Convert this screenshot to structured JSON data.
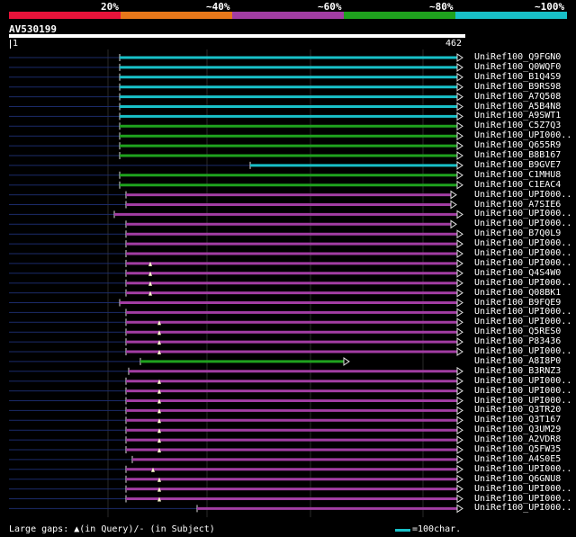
{
  "legend": {
    "labels": [
      "20%",
      "~40%",
      "~60%",
      "~80%",
      "~100%"
    ],
    "colors": [
      "#e8133a",
      "#e8781a",
      "#a23da3",
      "#1fa21e",
      "#18c0c8"
    ]
  },
  "query": {
    "name": "AV530199",
    "start": "1",
    "end": "462"
  },
  "footer": {
    "text": "Large gaps: ▲(in Query)/- (in Subject)",
    "scale": "=100char."
  },
  "hits": [
    {
      "label": "UniRef100_Q9FGN0",
      "color": "#18c0c8"
    },
    {
      "label": "UniRef100_Q0WQF0",
      "color": "#18c0c8"
    },
    {
      "label": "UniRef100_B1Q4S9",
      "color": "#18c0c8"
    },
    {
      "label": "UniRef100_B9RS98",
      "color": "#18c0c8"
    },
    {
      "label": "UniRef100_A7Q508",
      "color": "#18c0c8"
    },
    {
      "label": "UniRef100_A5B4N8",
      "color": "#18c0c8"
    },
    {
      "label": "UniRef100_A9SWT1",
      "color": "#18c0c8"
    },
    {
      "label": "UniRef100_C5Z7Q3",
      "color": "#1fa21e"
    },
    {
      "label": "UniRef100_UPI000..",
      "color": "#1fa21e"
    },
    {
      "label": "UniRef100_Q655R9",
      "color": "#1fa21e"
    },
    {
      "label": "UniRef100_B8B167",
      "color": "#1fa21e"
    },
    {
      "label": "UniRef100_B9GVE7",
      "color": "#18c0c8"
    },
    {
      "label": "UniRef100_C1MHU8",
      "color": "#1fa21e"
    },
    {
      "label": "UniRef100_C1EAC4",
      "color": "#1fa21e"
    },
    {
      "label": "UniRef100_UPI000..",
      "color": "#a23da3"
    },
    {
      "label": "UniRef100_A7SIE6",
      "color": "#a23da3"
    },
    {
      "label": "UniRef100_UPI000..",
      "color": "#a23da3"
    },
    {
      "label": "UniRef100_UPI000..",
      "color": "#a23da3"
    },
    {
      "label": "UniRef100_B7Q0L9",
      "color": "#a23da3"
    },
    {
      "label": "UniRef100_UPI000..",
      "color": "#a23da3"
    },
    {
      "label": "UniRef100_UPI000..",
      "color": "#a23da3"
    },
    {
      "label": "UniRef100_UPI000..",
      "color": "#a23da3"
    },
    {
      "label": "UniRef100_Q4S4W0",
      "color": "#a23da3"
    },
    {
      "label": "UniRef100_UPI000..",
      "color": "#a23da3"
    },
    {
      "label": "UniRef100_Q08BK1",
      "color": "#a23da3"
    },
    {
      "label": "UniRef100_B9FQE9",
      "color": "#a23da3"
    },
    {
      "label": "UniRef100_UPI000..",
      "color": "#a23da3"
    },
    {
      "label": "UniRef100_UPI000..",
      "color": "#a23da3"
    },
    {
      "label": "UniRef100_Q5RES0",
      "color": "#a23da3"
    },
    {
      "label": "UniRef100_P83436",
      "color": "#a23da3"
    },
    {
      "label": "UniRef100_UPI000..",
      "color": "#a23da3"
    },
    {
      "label": "UniRef100_A8I8P0",
      "color": "#1fa21e"
    },
    {
      "label": "UniRef100_B3RNZ3",
      "color": "#a23da3"
    },
    {
      "label": "UniRef100_UPI000..",
      "color": "#a23da3"
    },
    {
      "label": "UniRef100_UPI000..",
      "color": "#a23da3"
    },
    {
      "label": "UniRef100_UPI000..",
      "color": "#a23da3"
    },
    {
      "label": "UniRef100_Q3TR20",
      "color": "#a23da3"
    },
    {
      "label": "UniRef100_Q3T167",
      "color": "#a23da3"
    },
    {
      "label": "UniRef100_Q3UM29",
      "color": "#a23da3"
    },
    {
      "label": "UniRef100_A2VDR8",
      "color": "#a23da3"
    },
    {
      "label": "UniRef100_Q5FW35",
      "color": "#a23da3"
    },
    {
      "label": "UniRef100_A4S0E5",
      "color": "#a23da3"
    },
    {
      "label": "UniRef100_UPI000..",
      "color": "#a23da3"
    },
    {
      "label": "UniRef100_Q6GNU8",
      "color": "#a23da3"
    },
    {
      "label": "UniRef100_UPI000..",
      "color": "#a23da3"
    },
    {
      "label": "UniRef100_UPI000..",
      "color": "#a23da3"
    },
    {
      "label": "UniRef100_UPI000..",
      "color": "#a23da3"
    }
  ]
}
